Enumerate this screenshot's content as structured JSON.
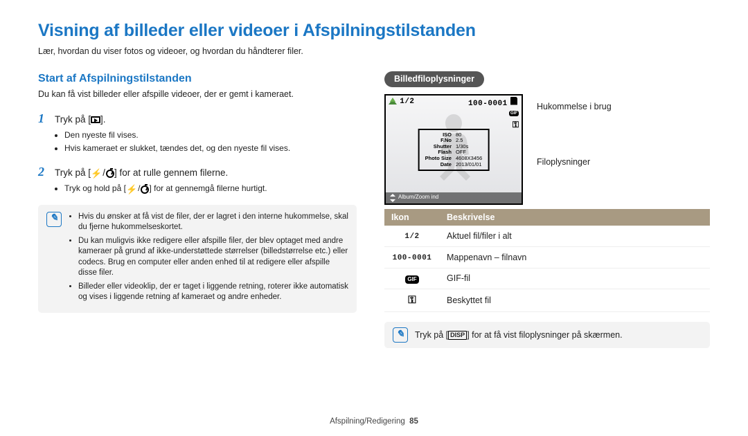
{
  "title": "Visning af billeder eller videoer i Afspilningstilstanden",
  "subtitle": "Lær, hvordan du viser fotos og videoer, og hvordan du håndterer filer.",
  "section_heading": "Start af Afspilningstilstanden",
  "section_desc": "Du kan få vist billeder eller afspille videoer, der er gemt i kameraet.",
  "step1": {
    "num": "1",
    "text_a": "Tryk på [",
    "text_b": "].",
    "b1": "Den nyeste fil vises.",
    "b2": "Hvis kameraet er slukket, tændes det, og den nyeste fil vises."
  },
  "step2": {
    "num": "2",
    "text_a": "Tryk på [",
    "text_b": "] for at rulle gennem filerne.",
    "b1_a": "Tryk og hold på [",
    "b1_b": "] for at gennemgå filerne hurtigt."
  },
  "note1": {
    "i1": "Hvis du ønsker at få vist de filer, der er lagret i den interne hukommelse, skal du fjerne hukommelseskortet.",
    "i2": "Du kan muligvis ikke redigere eller afspille filer, der blev optaget med andre kameraer på grund af ikke-understøttede størrelser (billedstørrelse etc.) eller codecs. Brug en computer eller anden enhed til at redigere eller afspille disse filer.",
    "i3": "Billeder eller videoklip, der er taget i liggende retning, roterer ikke automatisk og vises i liggende retning af kameraet og andre enheder."
  },
  "right_pill": "Billedfiloplysninger",
  "callout_mem": "Hukommelse i brug",
  "callout_info": "Filoplysninger",
  "screen": {
    "counter": "1/2",
    "file": "100-0001",
    "gif_label": "GIF",
    "iso_l": "ISO",
    "iso_v": "80",
    "fno_l": "F.No",
    "fno_v": "2.5",
    "sh_l": "Shutter",
    "sh_v": "1/30s",
    "fl_l": "Flash",
    "fl_v": "OFF",
    "ps_l": "Photo Size",
    "ps_v": "4608X3456",
    "dt_l": "Date",
    "dt_v": "2013/01/01",
    "bottom": "Album/Zoom ind"
  },
  "table": {
    "h1": "Ikon",
    "h2": "Beskrivelse",
    "r1_icon": "1/2",
    "r1": "Aktuel fil/filer i alt",
    "r2_icon": "100-0001",
    "r2": "Mappenavn – filnavn",
    "r3_icon": "GIF",
    "r3": "GIF-fil",
    "r4": "Beskyttet fil"
  },
  "note2_a": "Tryk på [",
  "note2_disp": "DISP",
  "note2_b": "] for at få vist filoplysninger på skærmen.",
  "footer_section": "Afspilning/Redigering",
  "footer_page": "85"
}
